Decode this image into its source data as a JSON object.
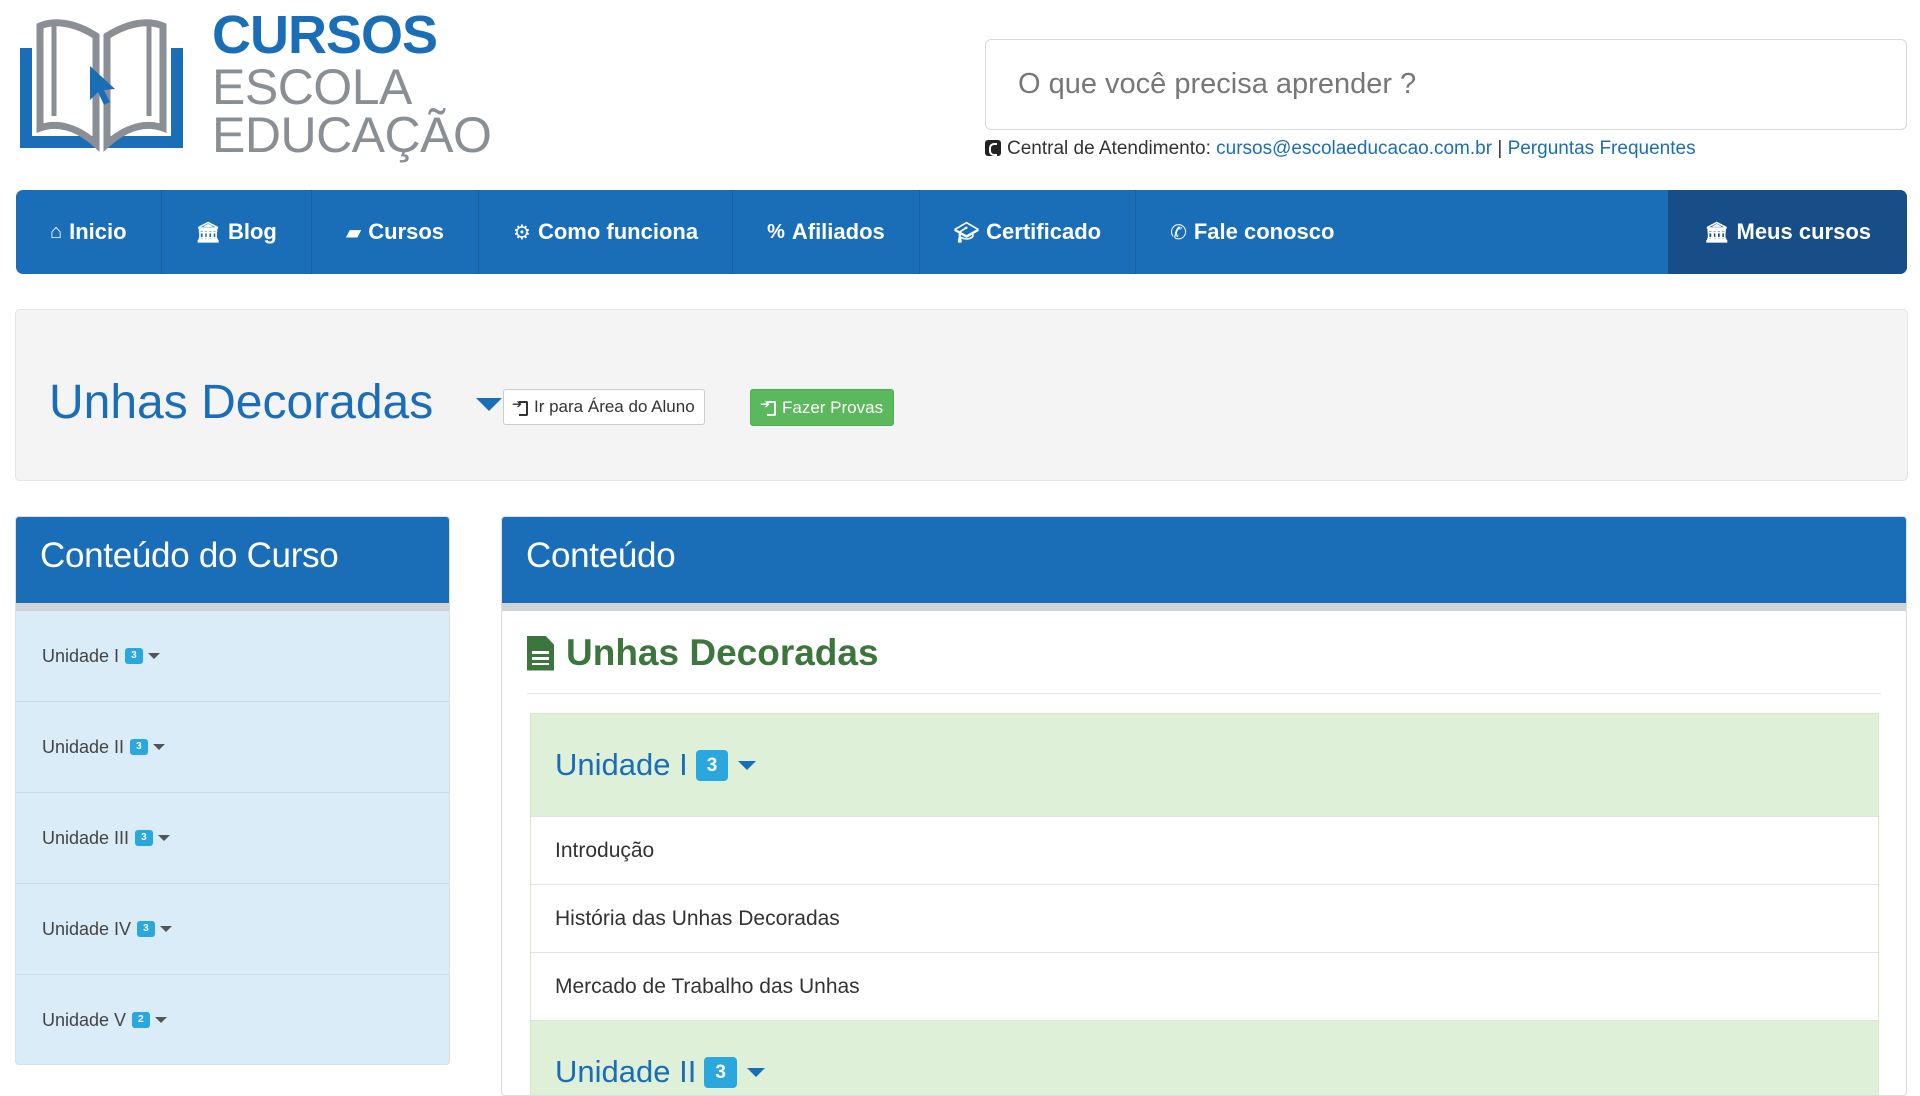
{
  "logo": {
    "line1": "CURSOS",
    "line2": "ESCOLA",
    "line3": "EDUCAÇÃO",
    "icon": "open-book-cursor-icon"
  },
  "search": {
    "placeholder": "O que você precisa aprender ?"
  },
  "support": {
    "label": "Central de Atendimento: ",
    "email": "cursos@escolaeducacao.com.br",
    "separator": " | ",
    "faq": "Perguntas Frequentes",
    "icon": "phone-square-icon"
  },
  "nav": {
    "items": [
      {
        "label": "Inicio",
        "icon": "home-icon"
      },
      {
        "label": "Blog",
        "icon": "bank-icon"
      },
      {
        "label": "Cursos",
        "icon": "book-icon"
      },
      {
        "label": "Como funciona",
        "icon": "gears-icon"
      },
      {
        "label": "Afiliados",
        "icon": "percent-icon"
      },
      {
        "label": "Certificado",
        "icon": "graduation-cap-icon"
      },
      {
        "label": "Fale conosco",
        "icon": "phone-icon"
      }
    ],
    "right": {
      "label": "Meus cursos",
      "icon": "bank-icon"
    }
  },
  "course": {
    "title": "Unhas Decoradas",
    "btn_aluno": "Ir para Área do Aluno",
    "btn_provas": "Fazer Provas"
  },
  "sidebar": {
    "heading": "Conteúdo do Curso",
    "units": [
      {
        "label": "Unidade I",
        "count": "3"
      },
      {
        "label": "Unidade II",
        "count": "3"
      },
      {
        "label": "Unidade III",
        "count": "3"
      },
      {
        "label": "Unidade IV",
        "count": "3"
      },
      {
        "label": "Unidade V",
        "count": "2"
      }
    ]
  },
  "main": {
    "heading": "Conteúdo",
    "title": "Unhas Decoradas",
    "groups": [
      {
        "label": "Unidade I",
        "count": "3",
        "lessons": [
          "Introdução",
          "História das Unhas Decoradas",
          "Mercado de Trabalho das Unhas"
        ]
      },
      {
        "label": "Unidade II",
        "count": "3",
        "lessons": []
      }
    ]
  },
  "colors": {
    "brand_blue": "#1a6eb8",
    "nav_dark": "#184e87",
    "success_green": "#5cb85c",
    "badge_blue": "#2aa7dc",
    "group_green_bg": "#dff0d8",
    "sidebar_bg": "#d9ecf7"
  }
}
